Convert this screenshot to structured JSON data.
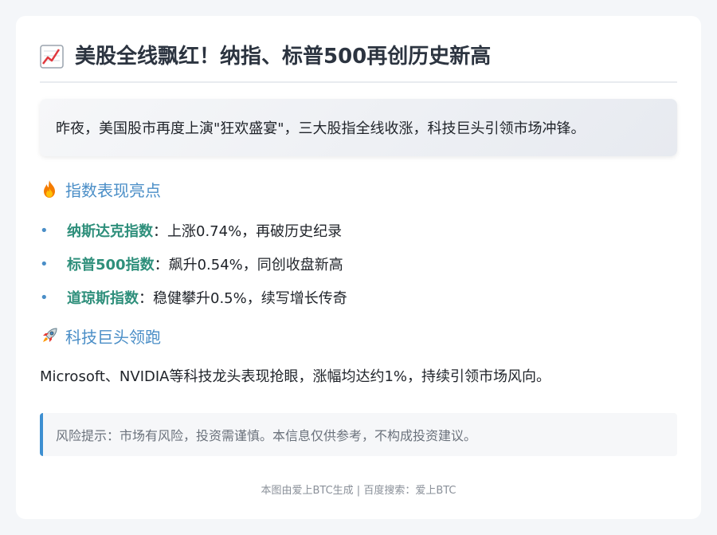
{
  "header": {
    "icon": "chart-increasing-icon",
    "title": "美股全线飘红！纳指、标普500再创历史新高"
  },
  "intro": {
    "text": "昨夜，美国股市再度上演\"狂欢盛宴\"，三大股指全线收涨，科技巨头引领市场冲锋。"
  },
  "index_section": {
    "icon": "fire-icon",
    "heading": "指数表现亮点",
    "items": [
      {
        "bullet": "•",
        "name": "纳斯达克指数",
        "desc": "：上涨0.74%，再破历史纪录"
      },
      {
        "bullet": "•",
        "name": "标普500指数",
        "desc": "：飙升0.54%，同创收盘新高"
      },
      {
        "bullet": "•",
        "name": "道琼斯指数",
        "desc": "：稳健攀升0.5%，续写增长传奇"
      }
    ]
  },
  "tech_section": {
    "icon": "rocket-icon",
    "heading": "科技巨头领跑",
    "text": "Microsoft、NVIDIA等科技龙头表现抢眼，涨幅均达约1%，持续引领市场风向。"
  },
  "risk": {
    "text": "风险提示：市场有风险，投资需谨慎。本信息仅供参考，不构成投资建议。"
  },
  "footer": {
    "text": "本图由爱上BTC生成 | 百度搜索：爱上BTC"
  },
  "colors": {
    "accent_blue": "#4a8ec7",
    "index_name_green": "#2e8f7b",
    "risk_border": "#3d8fd1",
    "title": "#2c3440"
  }
}
